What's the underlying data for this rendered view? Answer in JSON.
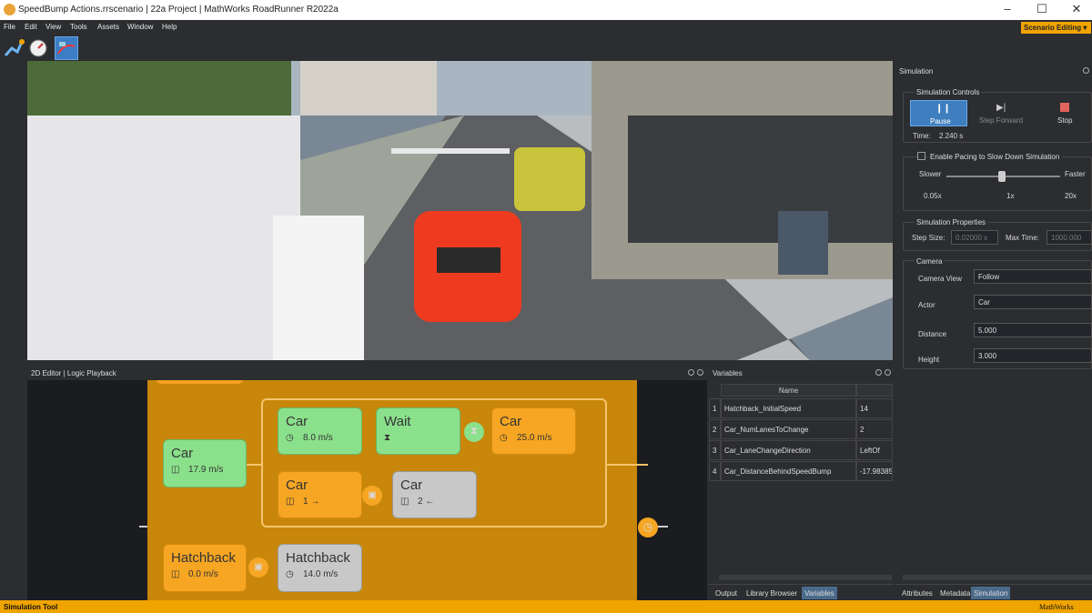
{
  "window": {
    "title": "SpeedBump Actions.rrscenario | 22a Project | MathWorks RoadRunner R2022a",
    "minimize": "–",
    "maximize": "☐",
    "close": "✕"
  },
  "menu": [
    "File",
    "Edit",
    "View",
    "Tools",
    "Assets",
    "Window",
    "Help"
  ],
  "mode_badge": "Scenario Editing",
  "editor_tabs": {
    "left": "2D Editor",
    "right": "Logic Playback",
    "sep": "|"
  },
  "logic": {
    "car_root": {
      "label": "Car",
      "value": "17.9 m/s"
    },
    "car_speed": {
      "label": "Car",
      "value": "8.0 m/s"
    },
    "wait": {
      "label": "Wait"
    },
    "car_speed2": {
      "label": "Car",
      "value": "25.0 m/s"
    },
    "car_lane": {
      "label": "Car",
      "value": "1 →"
    },
    "car_lane2": {
      "label": "Car",
      "value": "2 ←"
    },
    "hatch_root": {
      "label": "Hatchback",
      "value": "0.0 m/s"
    },
    "hatch_speed": {
      "label": "Hatchback",
      "value": "14.0 m/s"
    }
  },
  "variables": {
    "title": "Variables",
    "header": "Name",
    "rows": [
      {
        "n": "1",
        "name": "Hatchback_InitialSpeed",
        "value": "14"
      },
      {
        "n": "2",
        "name": "Car_NumLanesToChange",
        "value": "2"
      },
      {
        "n": "3",
        "name": "Car_LaneChangeDirection",
        "value": "LeftOf"
      },
      {
        "n": "4",
        "name": "Car_DistanceBehindSpeedBump",
        "value": "-17.98385"
      }
    ],
    "tabs": [
      "Output",
      "Library Browser",
      "Variables"
    ]
  },
  "simulation": {
    "title": "Simulation",
    "controls_title": "Simulation Controls",
    "pause": "Pause",
    "step_forward": "Step Forward",
    "stop": "Stop",
    "time_label": "Time:",
    "time_value": "2.240 s",
    "pacing_label": "Enable Pacing to Slow Down Simulation",
    "slower": "Slower",
    "faster": "Faster",
    "ticks": [
      "0.05x",
      "1x",
      "20x"
    ],
    "props_title": "Simulation Properties",
    "step_size_label": "Step Size:",
    "step_size_value": "0.02000 s",
    "max_time_label": "Max Time:",
    "max_time_value": "1000.000",
    "camera_title": "Camera",
    "camera_view_label": "Camera View",
    "camera_view_value": "Follow",
    "actor_label": "Actor",
    "actor_value": "Car",
    "distance_label": "Distance",
    "distance_value": "5.000",
    "height_label": "Height",
    "height_value": "3.000",
    "tabs": [
      "Attributes",
      "Metadata",
      "Simulation"
    ]
  },
  "status": {
    "left": "Simulation Tool",
    "right": "MathWorks"
  },
  "colors": {
    "accent": "#f0a400",
    "green_node": "#8be08b",
    "orange_node": "#f6a623",
    "gray_node": "#c8c8c8"
  }
}
